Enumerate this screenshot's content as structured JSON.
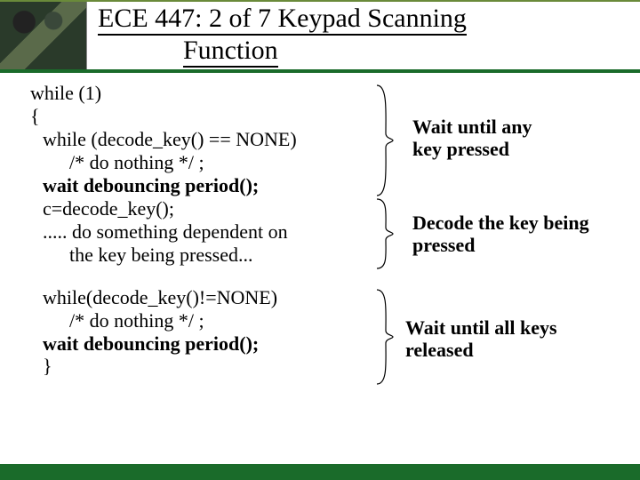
{
  "header": {
    "title_line1": "ECE 447: 2 of 7 Keypad Scanning",
    "title_line2": "Function"
  },
  "code": {
    "l1": "while (1)",
    "l2": "{",
    "l3": "while (decode_key() == NONE)",
    "l4": "/* do nothing */ ;",
    "l5": "wait debouncing period();",
    "l6": "c=decode_key();",
    "l7": "..... do something dependent on",
    "l8": "the key being pressed...",
    "l9": "while(decode_key()!=NONE)",
    "l10": "/* do nothing */ ;",
    "l11": "wait debouncing period();",
    "l12": "}"
  },
  "annotations": {
    "a1_l1": "Wait until any",
    "a1_l2": "key pressed",
    "a2_l1": "Decode the key being",
    "a2_l2": "pressed",
    "a3_l1": "Wait until all keys",
    "a3_l2": "released"
  },
  "colors": {
    "accent_green": "#1a6b2a"
  }
}
